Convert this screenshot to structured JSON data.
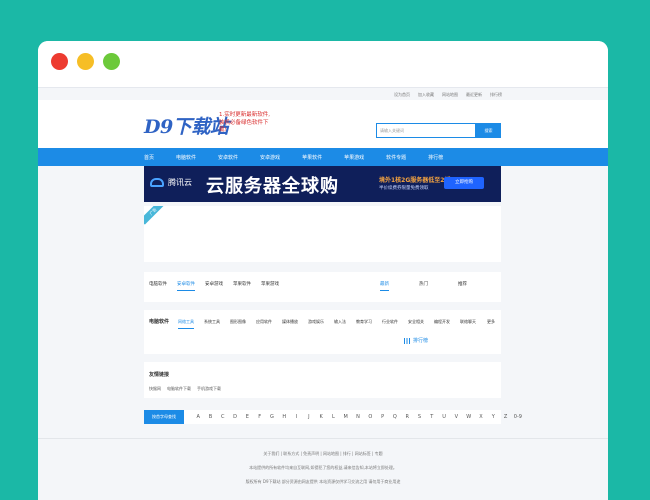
{
  "topbar": {
    "links": [
      "设为首页",
      "加入收藏",
      "网站地图",
      "最近更新",
      "排行榜"
    ]
  },
  "header": {
    "logo": "D9下载站",
    "slogan_1": "1.实时更新最新软件,",
    "slogan_2": "装机必备绿色软件下载!",
    "search_placeholder": "请输入关键词",
    "search_button": "搜索"
  },
  "nav": {
    "items": [
      "首页",
      "电脑软件",
      "安卓软件",
      "安卓游戏",
      "苹果软件",
      "苹果游戏",
      "软件专题",
      "排行榜"
    ]
  },
  "banner": {
    "brand": "腾讯云",
    "headline": "云服务器全球购",
    "offer": "境外1核2G服务器低至2折",
    "offer_sub": "半价续费券限量免费领取",
    "cta": "立即抢购"
  },
  "ad_tag": "广告",
  "tabs": {
    "items": [
      "电脑软件",
      "安卓软件",
      "安卓游戏",
      "苹果软件",
      "苹果游戏"
    ],
    "active": 1
  },
  "sort": {
    "items": [
      "最新",
      "热门",
      "推荐"
    ],
    "active": 0
  },
  "category": {
    "title": "电脑软件",
    "items": [
      "网络工具",
      "系统工具",
      "图形图像",
      "应用软件",
      "媒体播放",
      "游戏娱乐",
      "输入法",
      "教育学习",
      "行业软件",
      "安全相关",
      "编程开发",
      "联络聊天"
    ],
    "active": 0,
    "more": "更多",
    "rank_label": "排行榜"
  },
  "friend_links": {
    "title": "友情链接",
    "items": [
      "快猴网",
      "电脑软件下载",
      "手机游戏下载"
    ]
  },
  "letters": {
    "label": "按首字母查找",
    "items": [
      "A",
      "B",
      "C",
      "D",
      "E",
      "F",
      "G",
      "H",
      "I",
      "J",
      "K",
      "L",
      "M",
      "N",
      "O",
      "P",
      "Q",
      "R",
      "S",
      "T",
      "U",
      "V",
      "W",
      "X",
      "Y",
      "Z",
      "0-9"
    ]
  },
  "footer": {
    "line1": "关于我们 | 联系方式 | 免责声明 | 网站地图 | 排行 | 网站标签 | 专题",
    "line2": "本站提供的所有软件均来自互联网,如侵犯了您的权益,请来信告知,本站将立即处理。",
    "line3": "版权所有 D9下载站 部分资源由网友提供 本站资源仅供学习交流之用 请勿用于商业用途"
  },
  "colors": {
    "accent": "#1c8be6",
    "backdrop": "#1bb8a6",
    "page": "#f4f6f9"
  }
}
